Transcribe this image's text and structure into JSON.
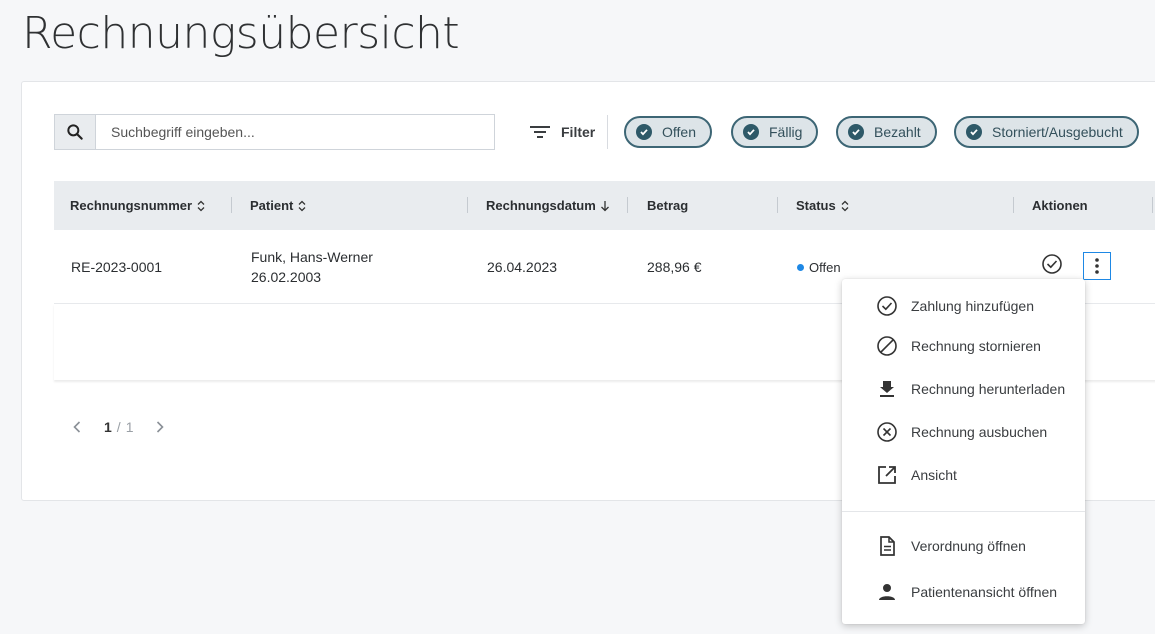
{
  "page": {
    "title": "Rechnungsübersicht"
  },
  "search": {
    "placeholder": "Suchbegriff eingeben...",
    "value": ""
  },
  "filter": {
    "label": "Filter"
  },
  "chips": [
    {
      "label": "Offen",
      "checked": true
    },
    {
      "label": "Fällig",
      "checked": true
    },
    {
      "label": "Bezahlt",
      "checked": true
    },
    {
      "label": "Storniert/Ausgebucht",
      "checked": true
    }
  ],
  "table": {
    "columns": [
      {
        "label": "Rechnungsnummer",
        "sort": "sortable"
      },
      {
        "label": "Patient",
        "sort": "sortable"
      },
      {
        "label": "Rechnungsdatum",
        "sort": "descending"
      },
      {
        "label": "Betrag",
        "sort": "none"
      },
      {
        "label": "Status",
        "sort": "sortable"
      },
      {
        "label": "Aktionen",
        "sort": "none"
      }
    ],
    "rows": [
      {
        "number": "RE-2023-0001",
        "patient_name": "Funk, Hans-Werner",
        "patient_dob": "26.02.2003",
        "date": "26.04.2023",
        "amount": "288,96 €",
        "status": "Offen",
        "status_color": "#1e88e5"
      }
    ]
  },
  "pagination": {
    "current": "1",
    "separator": "/",
    "total": "1"
  },
  "context_menu": {
    "items": [
      {
        "label": "Zahlung hinzufügen",
        "icon": "check-circle-icon"
      },
      {
        "label": "Rechnung stornieren",
        "icon": "cancel-circle-icon"
      },
      {
        "label": "Rechnung herunterladen",
        "icon": "download-icon"
      },
      {
        "label": "Rechnung ausbuchen",
        "icon": "close-circle-icon"
      },
      {
        "label": "Ansicht",
        "icon": "open-external-icon"
      },
      {
        "label": "Verordnung öffnen",
        "icon": "document-icon"
      },
      {
        "label": "Patientenansicht öffnen",
        "icon": "person-icon"
      }
    ]
  },
  "colors": {
    "accent": "#1e88e5",
    "chip_border": "#3d6675",
    "chip_bg": "#dde4e8"
  }
}
